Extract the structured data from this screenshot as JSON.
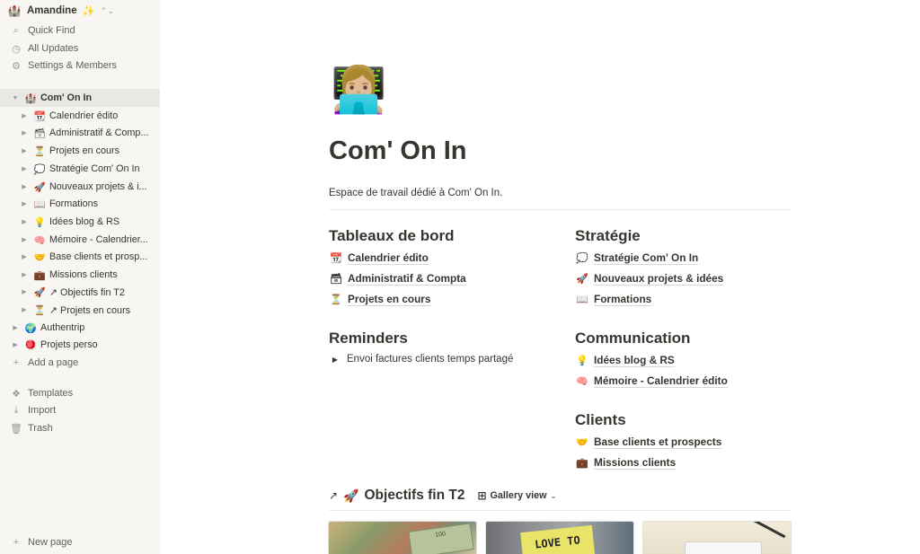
{
  "sidebar": {
    "workspace": {
      "emoji": "🏰",
      "name": "Amandine",
      "sparkle": "✨",
      "chevron": "⌃⌄"
    },
    "top_items": [
      {
        "icon": "search-icon",
        "glyph": "⌕",
        "label": "Quick Find"
      },
      {
        "icon": "clock-icon",
        "glyph": "◷",
        "label": "All Updates"
      },
      {
        "icon": "gear-icon",
        "glyph": "⚙",
        "label": "Settings & Members"
      }
    ],
    "tree": [
      {
        "emoji": "🏰",
        "label": "Com' On In",
        "expanded": true,
        "depth": 0,
        "active": true
      },
      {
        "emoji": "📆",
        "label": "Calendrier édito",
        "depth": 1
      },
      {
        "emoji": "🗃",
        "label": "Administratif & Comp...",
        "depth": 1
      },
      {
        "emoji": "⏳",
        "label": "Projets en cours",
        "depth": 1
      },
      {
        "emoji": "💭",
        "label": "Stratégie Com' On In",
        "depth": 1
      },
      {
        "emoji": "🚀",
        "label": "Nouveaux projets & i...",
        "depth": 1
      },
      {
        "emoji": "📖",
        "label": "Formations",
        "depth": 1
      },
      {
        "emoji": "💡",
        "label": "Idées blog & RS",
        "depth": 1
      },
      {
        "emoji": "🧠",
        "label": "Mémoire - Calendrier...",
        "depth": 1
      },
      {
        "emoji": "🤝",
        "label": "Base clients et prosp...",
        "depth": 1
      },
      {
        "emoji": "💼",
        "label": "Missions clients",
        "depth": 1
      },
      {
        "emoji": "🚀",
        "label": "↗ Objectifs fin T2",
        "depth": 1
      },
      {
        "emoji": "⏳",
        "label": "↗ Projets en cours",
        "depth": 1
      },
      {
        "emoji": "🌍",
        "label": "Authentrip",
        "depth": 0
      },
      {
        "emoji": "🪀",
        "label": "Projets perso",
        "depth": 0
      }
    ],
    "add_page": {
      "glyph": "+",
      "label": "Add a page"
    },
    "bottom_items": [
      {
        "icon": "templates-icon",
        "glyph": "❖",
        "label": "Templates"
      },
      {
        "icon": "import-icon",
        "glyph": "⤓",
        "label": "Import"
      },
      {
        "icon": "trash-icon",
        "glyph": "🗑",
        "label": "Trash"
      }
    ],
    "new_page": {
      "glyph": "+",
      "label": "New page"
    }
  },
  "page": {
    "icon": "👩🏼‍💻",
    "title": "Com' On In",
    "description": "Espace de travail dédié à Com' On In.",
    "sections": {
      "tableaux": {
        "heading": "Tableaux de bord",
        "links": [
          {
            "emoji": "📆",
            "label": "Calendrier édito"
          },
          {
            "emoji": "🗃",
            "label": "Administratif & Compta"
          },
          {
            "emoji": "⏳",
            "label": "Projets en cours"
          }
        ]
      },
      "reminders": {
        "heading": "Reminders",
        "items": [
          {
            "glyph": "▶",
            "label": "Envoi factures clients temps partagé"
          }
        ]
      },
      "strategie": {
        "heading": "Stratégie",
        "links": [
          {
            "emoji": "💭",
            "label": "Stratégie Com' On In"
          },
          {
            "emoji": "🚀",
            "label": "Nouveaux projets & idées"
          },
          {
            "emoji": "📖",
            "label": "Formations"
          }
        ]
      },
      "communication": {
        "heading": "Communication",
        "links": [
          {
            "emoji": "💡",
            "label": "Idées blog & RS"
          },
          {
            "emoji": "🧠",
            "label": "Mémoire - Calendrier édito"
          }
        ]
      },
      "clients": {
        "heading": "Clients",
        "links": [
          {
            "emoji": "🤝",
            "label": "Base clients et prospects"
          },
          {
            "emoji": "💼",
            "label": "Missions clients"
          }
        ]
      }
    },
    "database": {
      "arrow": "↗",
      "emoji": "🚀",
      "title": "Objectifs fin T2",
      "view_glyph": "⊞",
      "view_label": "Gallery view",
      "view_chevron": "⌄",
      "card_text": {
        "sign": "LOVE TO",
        "bill": "100"
      }
    }
  },
  "colors": {
    "sidebar_bg": "#f7f6f3",
    "active_row": "#e9e8e5",
    "text": "#37352f",
    "muted": "#9b9a97"
  }
}
